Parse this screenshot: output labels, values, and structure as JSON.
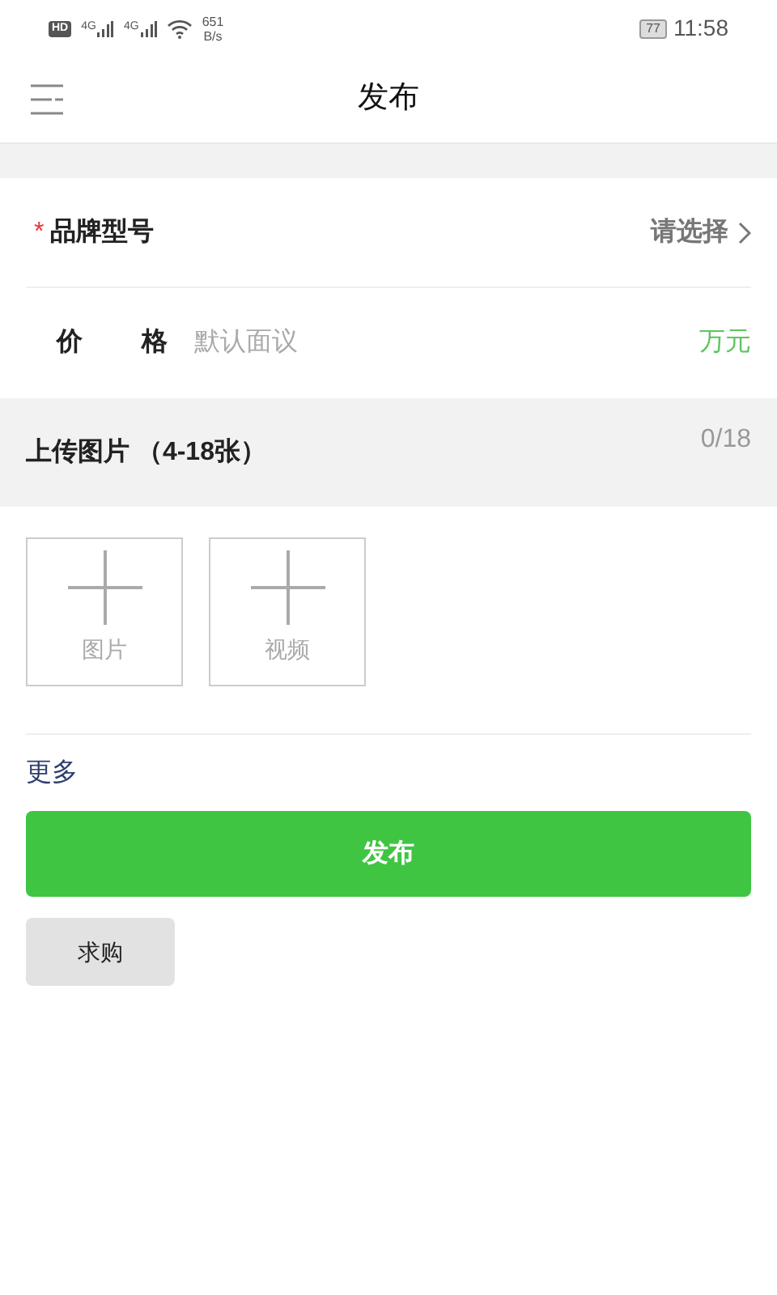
{
  "status_bar": {
    "hd": "HD",
    "signals": [
      "4G",
      "4G"
    ],
    "speed": "651",
    "speed_unit": "B/s",
    "battery": "77",
    "time": "11:58"
  },
  "header": {
    "title": "发布"
  },
  "form": {
    "brand": {
      "label": "品牌型号",
      "required_mark": "*",
      "value": "请选择"
    },
    "price": {
      "label": "价 格",
      "placeholder": "默认面议",
      "unit": "万元"
    }
  },
  "upload": {
    "title": "上传图片 （4-18张）",
    "count": "0/18",
    "tiles": [
      {
        "label": "图片"
      },
      {
        "label": "视频"
      }
    ]
  },
  "more_link": "更多",
  "publish_button": "发布",
  "buy_button": "求购"
}
